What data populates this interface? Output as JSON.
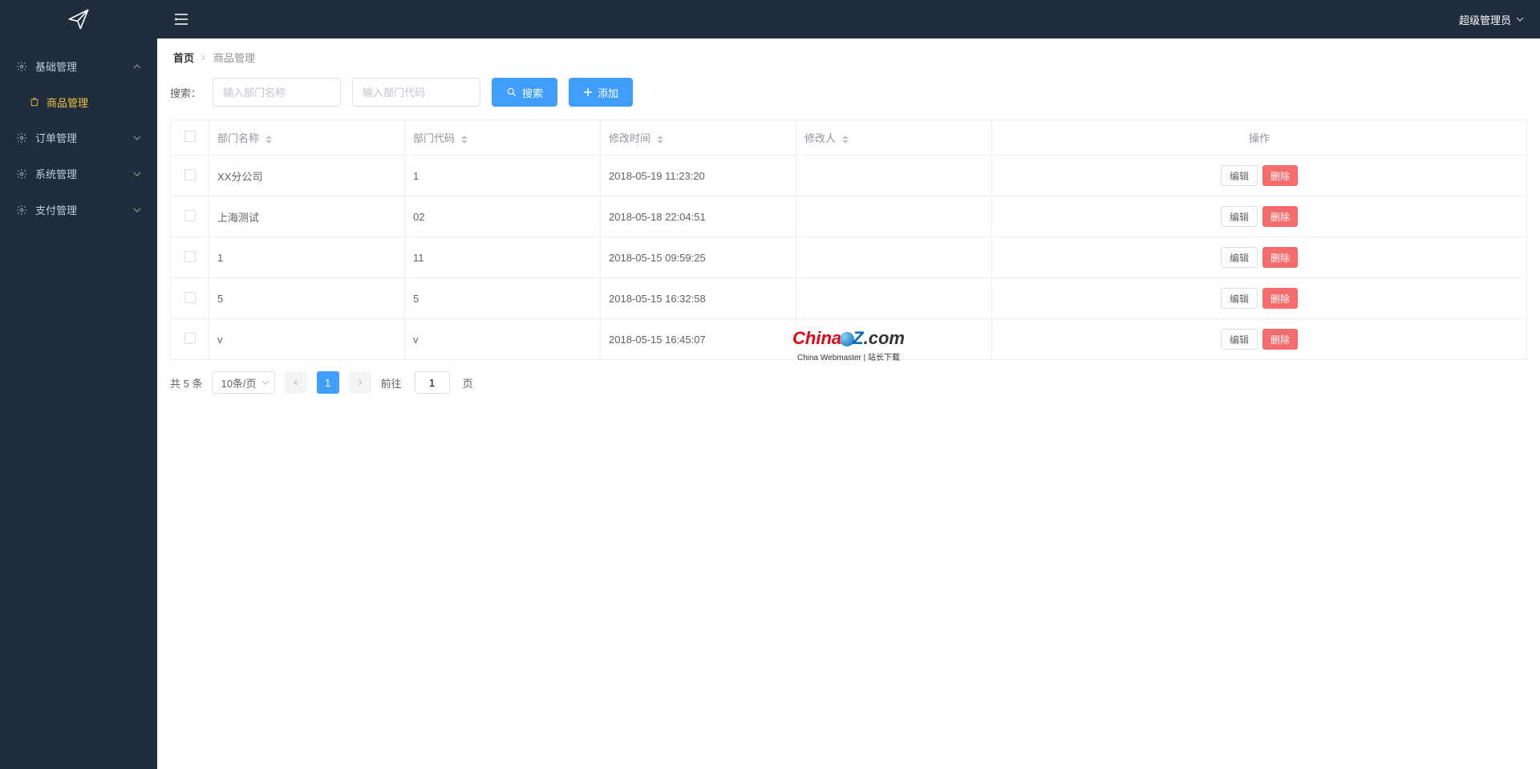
{
  "header": {
    "username": "超级管理员"
  },
  "sidebar": {
    "items": [
      {
        "label": "基础管理",
        "expanded": true,
        "children": [
          {
            "label": "商品管理",
            "active": true
          }
        ]
      },
      {
        "label": "订单管理",
        "expanded": false
      },
      {
        "label": "系统管理",
        "expanded": false
      },
      {
        "label": "支付管理",
        "expanded": false
      }
    ]
  },
  "breadcrumb": {
    "home": "首页",
    "current": "商品管理"
  },
  "toolbar": {
    "search_label": "搜索：",
    "name_placeholder": "输入部门名称",
    "code_placeholder": "输入部门代码",
    "search_btn": "搜索",
    "add_btn": "添加"
  },
  "table": {
    "columns": {
      "name": "部门名称",
      "code": "部门代码",
      "updated_at": "修改时间",
      "updated_by": "修改人",
      "ops": "操作"
    },
    "ops": {
      "edit": "编辑",
      "delete": "删除"
    },
    "rows": [
      {
        "name": "XX分公司",
        "code": "1",
        "updated_at": "2018-05-19 11:23:20",
        "updated_by": ""
      },
      {
        "name": "上海测试",
        "code": "02",
        "updated_at": "2018-05-18 22:04:51",
        "updated_by": ""
      },
      {
        "name": "1",
        "code": "11",
        "updated_at": "2018-05-15 09:59:25",
        "updated_by": ""
      },
      {
        "name": "5",
        "code": "5",
        "updated_at": "2018-05-15 16:32:58",
        "updated_by": ""
      },
      {
        "name": "v",
        "code": "v",
        "updated_at": "2018-05-15 16:45:07",
        "updated_by": ""
      }
    ]
  },
  "pagination": {
    "total_text": "共 5 条",
    "page_size_label": "10条/页",
    "current_page": "1",
    "jump_prefix": "前往",
    "jump_suffix": "页",
    "jump_value": "1"
  },
  "watermark": {
    "main_china": "China",
    "main_z": "Z",
    "main_com": ".com",
    "sub": "China Webmaster | 站长下载"
  }
}
